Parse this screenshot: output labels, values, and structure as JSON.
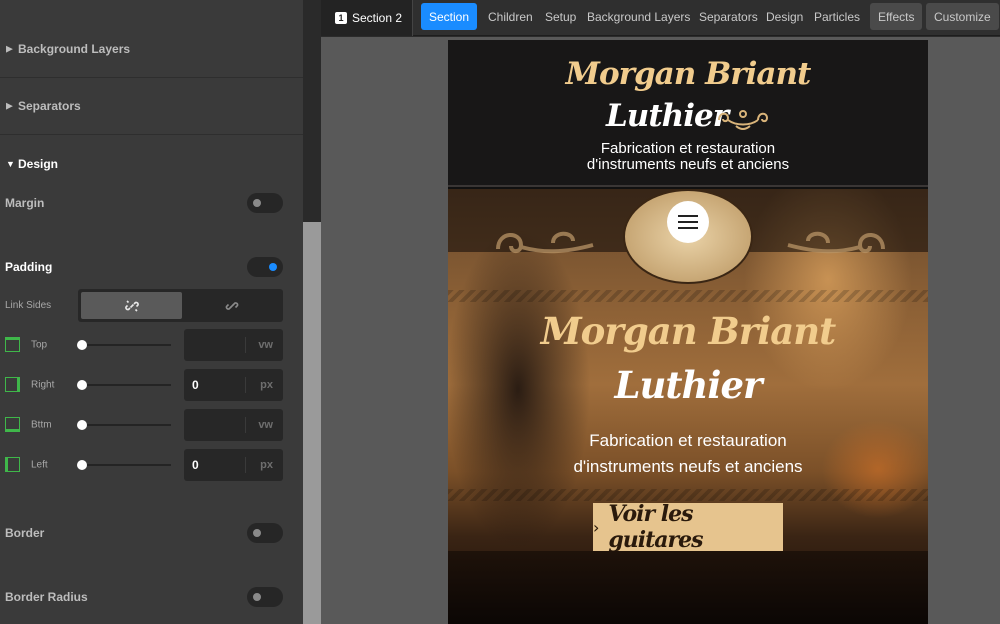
{
  "panel": {
    "sections": {
      "background_layers": "Background Layers",
      "separators": "Separators",
      "design": "Design"
    },
    "options": {
      "margin": "Margin",
      "padding": "Padding",
      "border": "Border",
      "border_radius": "Border Radius"
    },
    "toggles": {
      "margin": false,
      "padding": true,
      "border": false,
      "border_radius": false
    },
    "link_sides_label": "Link Sides",
    "padding_sides": [
      {
        "label": "Top",
        "value": "",
        "unit": "vw"
      },
      {
        "label": "Right",
        "value": "0",
        "unit": "px"
      },
      {
        "label": "Bttm",
        "value": "",
        "unit": "vw"
      },
      {
        "label": "Left",
        "value": "0",
        "unit": "px"
      }
    ]
  },
  "topbar": {
    "breadcrumb_num": "1",
    "breadcrumb": "Section 2",
    "tabs": [
      "Section",
      "Children",
      "Setup",
      "Background Layers",
      "Separators",
      "Design",
      "Particles",
      "Effects",
      "Customize"
    ],
    "selected_tab": "Section"
  },
  "preview": {
    "header_title_1": "Morgan Briant",
    "header_title_2": "Luthier",
    "header_sub_1": "Fabrication et restauration",
    "header_sub_2": "d'instruments neufs et anciens",
    "hero_title_1": "Morgan Briant",
    "hero_title_2": "Luthier",
    "hero_sub_1": "Fabrication et restauration",
    "hero_sub_2": "d'instruments neufs et anciens",
    "cta": "Voir les guitares"
  },
  "colors": {
    "accent": "#1a8cff",
    "brand_gold": "#f1cc8d",
    "cta_bg": "#e6c48e",
    "toggle_on": "#1a8cff",
    "side_icon": "#3fb74a"
  },
  "icons": [
    "caret-right-icon",
    "caret-down-icon",
    "link-broken-icon",
    "link-icon",
    "padding-side-icon",
    "hamburger-menu-icon",
    "chevron-right-icon",
    "flourish-ornament-icon"
  ]
}
